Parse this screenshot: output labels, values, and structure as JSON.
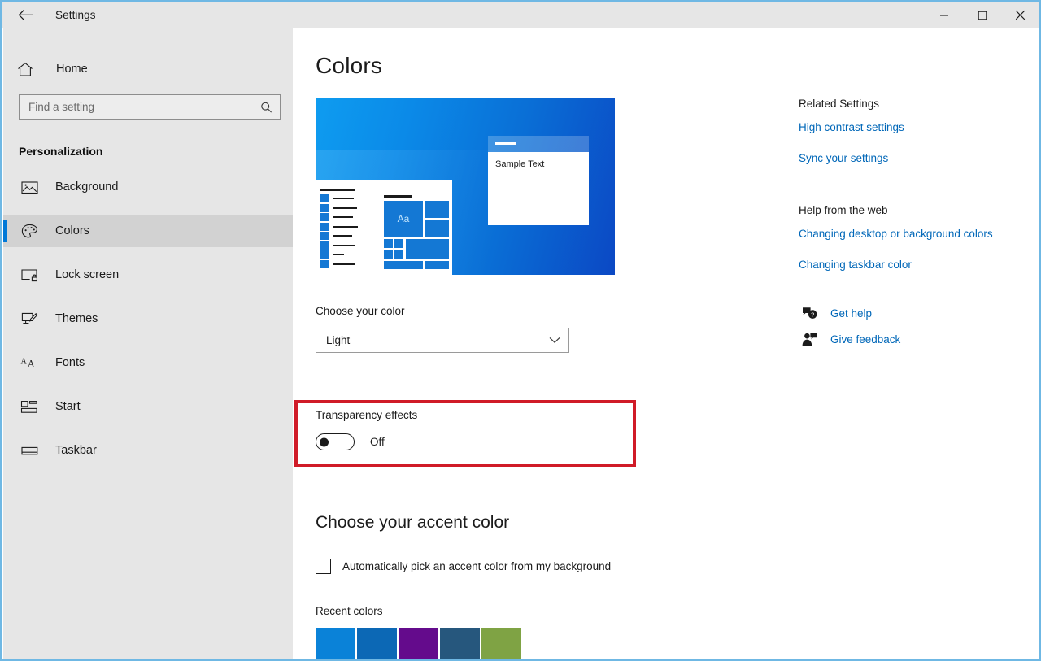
{
  "titlebar": {
    "back_icon": "back-arrow-icon",
    "title": "Settings",
    "minimize_label": "Minimize",
    "maximize_label": "Maximize",
    "close_label": "Close"
  },
  "sidebar": {
    "home_icon": "home-icon",
    "home_label": "Home",
    "search": {
      "placeholder": "Find a setting",
      "value": "",
      "icon": "search-icon"
    },
    "category": "Personalization",
    "items": [
      {
        "label": "Background",
        "icon": "picture-icon",
        "selected": false
      },
      {
        "label": "Colors",
        "icon": "palette-icon",
        "selected": true
      },
      {
        "label": "Lock screen",
        "icon": "lock-screen-icon",
        "selected": false
      },
      {
        "label": "Themes",
        "icon": "themes-icon",
        "selected": false
      },
      {
        "label": "Fonts",
        "icon": "fonts-icon",
        "selected": false
      },
      {
        "label": "Start",
        "icon": "start-icon",
        "selected": false
      },
      {
        "label": "Taskbar",
        "icon": "taskbar-icon",
        "selected": false
      }
    ]
  },
  "main": {
    "page_title": "Colors",
    "preview": {
      "sample_text": "Sample Text",
      "tile_text": "Aa",
      "accent_color": "#1478d4",
      "wallpaper_from": "#0e9cf0",
      "wallpaper_to": "#0b48c4"
    },
    "choose_color": {
      "label": "Choose your color",
      "value": "Light",
      "chevron_icon": "chevron-down-icon"
    },
    "transparency": {
      "label": "Transparency effects",
      "state": "Off",
      "checked": false,
      "highlight_color": "#d01b28"
    },
    "accent_section": {
      "heading": "Choose your accent color",
      "auto_pick_label": "Automatically pick an accent color from my background",
      "auto_pick_checked": false,
      "recent_label": "Recent colors",
      "recent_colors": [
        "#0a82d8",
        "#0c68b5",
        "#640b8c",
        "#26577d",
        "#7fa344"
      ]
    }
  },
  "rail": {
    "related_heading": "Related Settings",
    "related_links": [
      "High contrast settings",
      "Sync your settings"
    ],
    "help_heading": "Help from the web",
    "help_links": [
      "Changing desktop or background colors",
      "Changing taskbar color"
    ],
    "support": [
      {
        "label": "Get help",
        "icon": "get-help-icon"
      },
      {
        "label": "Give feedback",
        "icon": "give-feedback-icon"
      }
    ]
  }
}
